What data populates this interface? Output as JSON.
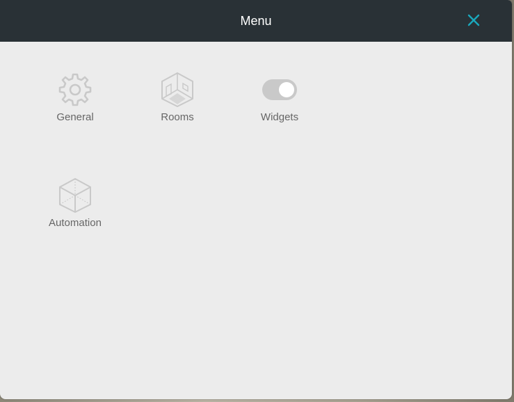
{
  "header": {
    "title": "Menu",
    "close_icon": "close-x-icon"
  },
  "menu": {
    "items": [
      {
        "label": "General",
        "icon": "gear-icon"
      },
      {
        "label": "Rooms",
        "icon": "room-cube-icon"
      },
      {
        "label": "Widgets",
        "icon": "toggle-switch-icon"
      },
      {
        "label": "Automation",
        "icon": "cube-icon"
      }
    ]
  },
  "colors": {
    "header_bg": "#293136",
    "panel_bg": "#ececec",
    "accent": "#1aa8bd",
    "icon": "#c9c9c9",
    "label": "#666666"
  }
}
